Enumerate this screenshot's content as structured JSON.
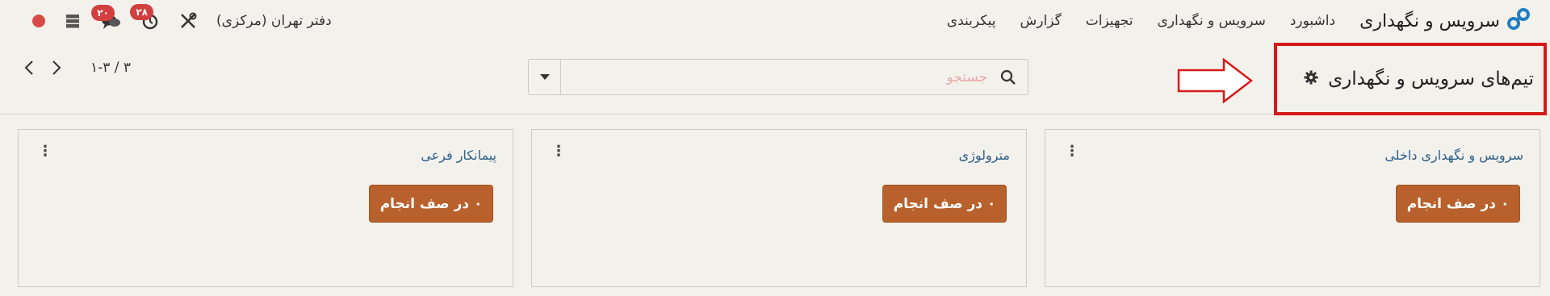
{
  "app": {
    "brand_title": "سرویس و نگهداری"
  },
  "menu": [
    {
      "label": "داشبورد"
    },
    {
      "label": "سرویس و نگهداری"
    },
    {
      "label": "تجهیزات"
    },
    {
      "label": "گزارش"
    },
    {
      "label": "پیکربندی"
    }
  ],
  "systray": {
    "company": "دفتر تهران (مرکزی)",
    "activity_count": "۲۸",
    "messages_count": "۲۰"
  },
  "control_panel": {
    "page_title": "تیم‌های سرویس و نگهداری",
    "search_placeholder": "جستجو",
    "pager_value": "۱-۳ / ۳"
  },
  "cards": [
    {
      "name": "سرویس و نگهداری داخلی",
      "button_label": "۰ در صف انجام"
    },
    {
      "name": "مترولوژی",
      "button_label": "۰ در صف انجام"
    },
    {
      "name": "پیمانکار فرعی",
      "button_label": "۰ در صف انجام"
    }
  ],
  "colors": {
    "brand_accent": "#1f7fc4",
    "primary_button": "#b8612c",
    "badge": "#d23f3f",
    "highlight_box": "#d61a1a",
    "background": "#f3f1ec"
  }
}
